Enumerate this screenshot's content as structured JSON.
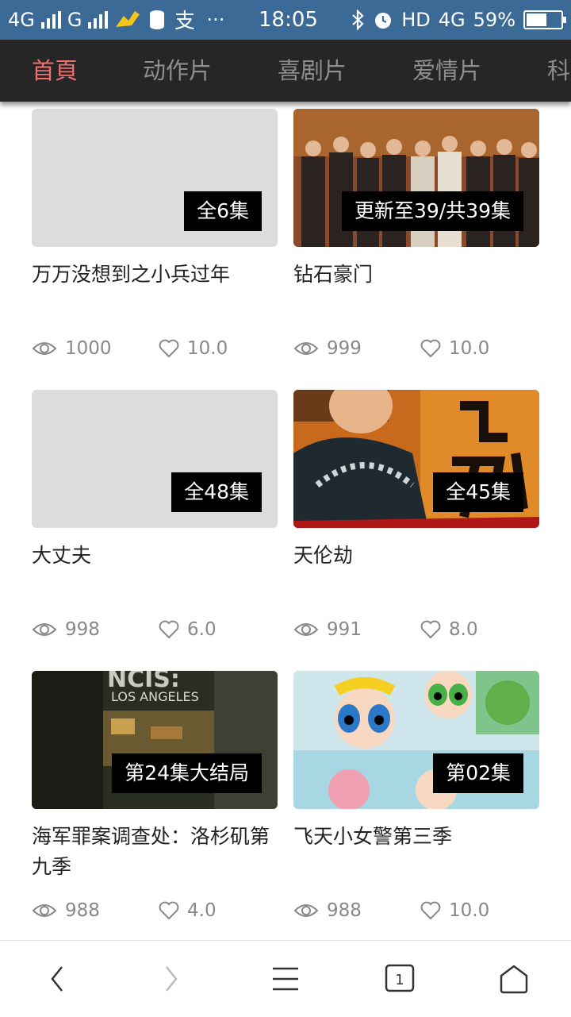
{
  "status_bar": {
    "network_1": "4G",
    "network_2": "G",
    "time": "18:05",
    "hd_label": "HD",
    "network_right": "4G",
    "battery_percent": "59%",
    "battery_level": 0.59
  },
  "nav": {
    "tabs": [
      {
        "label": "首頁",
        "active": true
      },
      {
        "label": "动作片",
        "active": false
      },
      {
        "label": "喜剧片",
        "active": false
      },
      {
        "label": "爱情片",
        "active": false
      },
      {
        "label": "科",
        "active": false
      }
    ]
  },
  "cards": [
    {
      "title": "万万没想到之小兵过年",
      "badge": "全6集",
      "views": "1000",
      "rating": "10.0",
      "poster": "placeholder"
    },
    {
      "title": "钻石豪门",
      "badge": "更新至39/共39集",
      "views": "999",
      "rating": "10.0",
      "poster": "group-photo"
    },
    {
      "title": "大丈夫",
      "badge": "全48集",
      "views": "998",
      "rating": "6.0",
      "poster": "placeholder"
    },
    {
      "title": "天伦劫",
      "badge": "全45集",
      "views": "991",
      "rating": "8.0",
      "poster": "drama-poster"
    },
    {
      "title": "海军罪案调查处：洛杉矶第九季",
      "badge": "第24集大结局",
      "views": "988",
      "rating": "4.0",
      "poster": "ncis-poster"
    },
    {
      "title": "飞天小女警第三季",
      "badge": "第02集",
      "views": "988",
      "rating": "10.0",
      "poster": "cartoon-poster"
    }
  ],
  "poster_texts": {
    "ncis_line1": "NCIS:",
    "ncis_line2": "LOS ANGELES"
  },
  "bottom_bar": {
    "tab_count": "1"
  },
  "colors": {
    "status_bar": "#3c6a96",
    "nav_bg": "#262626",
    "active_tab": "#f36e6e",
    "inactive_tab": "#8e8e8e",
    "badge_bg": "#000000"
  }
}
